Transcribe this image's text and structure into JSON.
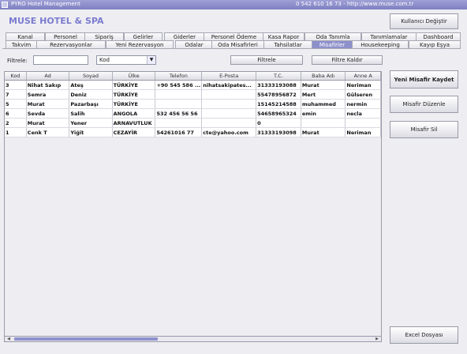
{
  "window": {
    "title": "PYRO Hotel Management",
    "contact": "0 542 610 16 73 - http://www.muse.com.tr"
  },
  "brand": "MUSE HOTEL & SPA",
  "user_button": "Kullanıcı Değiştir",
  "tabs_row1": [
    "Kanal",
    "Personel",
    "Sipariş",
    "Gelirler",
    "Giderler",
    "Personel Ödeme",
    "Kasa Rapor",
    "Oda Tanımla",
    "Tanımlamalar",
    "Dashboard"
  ],
  "tabs_row2": [
    "Takvim",
    "Rezervasyonlar",
    "Yeni Rezervasyon",
    "Odalar",
    "Oda Misafirleri",
    "Tahsilatlar",
    "Misafirler",
    "Housekeeping",
    "Kayıp Eşya"
  ],
  "active_tab": "Misafirler",
  "filter": {
    "label": "Filtrele:",
    "input_value": "",
    "field_selected": "Kod",
    "apply_button": "Filtrele",
    "clear_button": "Filtre Kaldır"
  },
  "table": {
    "columns": [
      "Kod",
      "Ad",
      "Soyad",
      "Ülke",
      "Telefon",
      "E-Posta",
      "T.C.",
      "Baba Adı",
      "Anne A"
    ],
    "rows": [
      [
        "3",
        "Nihat Sakıp",
        "Ateş",
        "TÜRKİYE",
        "+90 545 586 ...",
        "nihatsakipates...",
        "31333193088",
        "Murat",
        "Neriman"
      ],
      [
        "7",
        "Semra",
        "Deniz",
        "TÜRKİYE",
        "",
        "",
        "55478956872",
        "Mert",
        "Gülseren"
      ],
      [
        "5",
        "Murat",
        "Pazarbaşı",
        "TÜRKİYE",
        "",
        "",
        "15145214588",
        "muhammed",
        "nermin"
      ],
      [
        "6",
        "Sevda",
        "Salih",
        "ANGOLA",
        "532 456 56 56",
        "",
        "54658965324",
        "emin",
        "necla"
      ],
      [
        "2",
        "Murat",
        "Yener",
        "ARNAVUTLUK",
        "",
        "",
        "0",
        "",
        ""
      ],
      [
        "1",
        "Cenk T",
        "Yiğit",
        "CEZAYİR",
        "54261016 77",
        "cte@yahoo.com",
        "31333193098",
        "Murat",
        "Neriman"
      ]
    ]
  },
  "actions": {
    "new_guest": "Yeni Misafir Kaydet",
    "edit_guest": "Misafir Düzenle",
    "delete_guest": "Misafir Sil",
    "excel": "Excel Dosyası"
  }
}
